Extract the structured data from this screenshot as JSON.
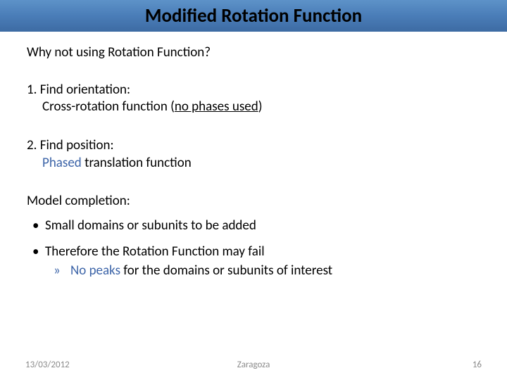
{
  "title": "Modified Rotation Function",
  "question": "Why not using Rotation Function?",
  "step1": {
    "heading": "1. Find orientation:",
    "body_pre": "Cross-rotation function (",
    "body_underline": "no phases used",
    "body_post": ")"
  },
  "step2": {
    "heading": "2. Find position:",
    "phased": "Phased",
    "rest": " translation function"
  },
  "model_completion": {
    "heading": "Model completion:",
    "bullet1": "Small domains or subunits to be added",
    "bullet2": "Therefore the Rotation Function may fail",
    "sub_colored": "No peaks",
    "sub_rest": " for the domains or subunits of interest"
  },
  "footer": {
    "date": "13/03/2012",
    "location": "Zaragoza",
    "page": "16"
  }
}
